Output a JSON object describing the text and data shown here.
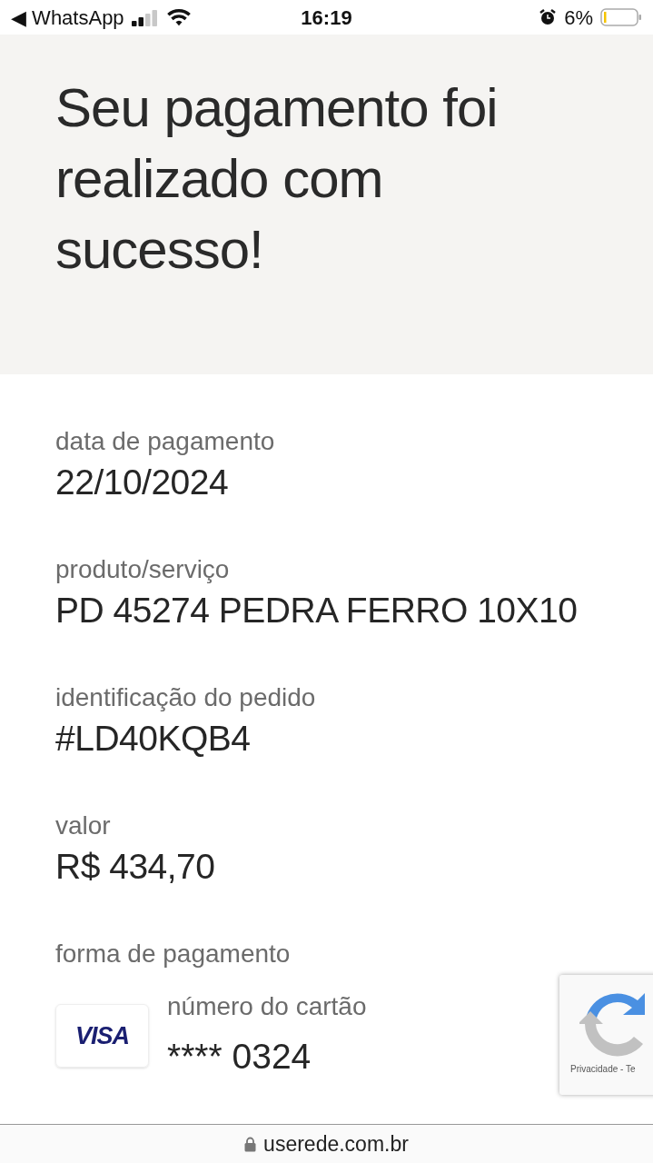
{
  "status_bar": {
    "back_label": "◀ WhatsApp",
    "time": "16:19",
    "battery": "6%"
  },
  "title": "Seu pagamento foi realizado com sucesso!",
  "fields": [
    {
      "label": "data de pagamento",
      "value": "22/10/2024"
    },
    {
      "label": "produto/serviço",
      "value": "PD 45274 PEDRA FERRO 10X10"
    },
    {
      "label": "identificação do pedido",
      "value": "#LD40KQB4"
    },
    {
      "label": "valor",
      "value": "R$ 434,70"
    }
  ],
  "payment": {
    "label": "forma de pagamento",
    "card_brand": "VISA",
    "card_label": "número do cartão",
    "card_number": "**** 0324"
  },
  "recaptcha": {
    "text": "Privacidade - Te"
  },
  "url_bar": {
    "url": "userede.com.br"
  }
}
